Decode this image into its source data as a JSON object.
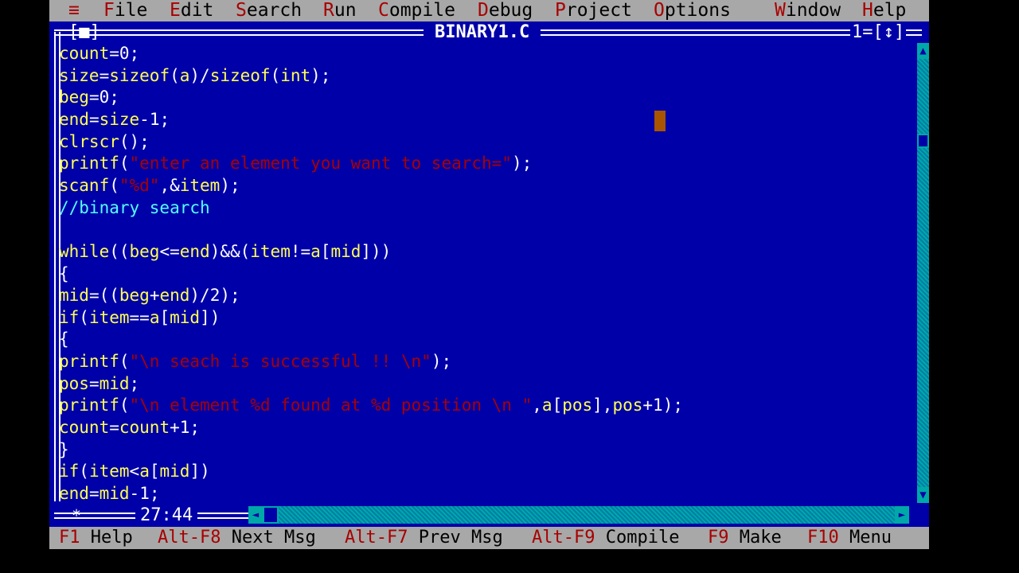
{
  "menu": {
    "system": "≡",
    "items": [
      {
        "hot": "F",
        "rest": "ile"
      },
      {
        "hot": "E",
        "rest": "dit"
      },
      {
        "hot": "S",
        "rest": "earch"
      },
      {
        "hot": "R",
        "rest": "un"
      },
      {
        "hot": "C",
        "rest": "ompile"
      },
      {
        "hot": "D",
        "rest": "ebug"
      },
      {
        "hot": "P",
        "rest": "roject"
      },
      {
        "hot": "O",
        "rest": "ptions"
      },
      {
        "hot": "W",
        "rest": "indow"
      },
      {
        "hot": "H",
        "rest": "elp"
      }
    ]
  },
  "window": {
    "close_box": "[■]",
    "title": "BINARY1.C",
    "number": "1=[↕]"
  },
  "editor": {
    "lines": [
      [
        {
          "t": "count",
          "c": "id"
        },
        {
          "t": "=",
          "c": "op"
        },
        {
          "t": "0",
          "c": "num"
        },
        {
          "t": ";",
          "c": "op"
        }
      ],
      [
        {
          "t": "size",
          "c": "id"
        },
        {
          "t": "=",
          "c": "op"
        },
        {
          "t": "sizeof",
          "c": "id"
        },
        {
          "t": "(",
          "c": "op"
        },
        {
          "t": "a",
          "c": "id"
        },
        {
          "t": ")/",
          "c": "op"
        },
        {
          "t": "sizeof",
          "c": "id"
        },
        {
          "t": "(",
          "c": "op"
        },
        {
          "t": "int",
          "c": "id"
        },
        {
          "t": ");",
          "c": "op"
        }
      ],
      [
        {
          "t": "beg",
          "c": "id"
        },
        {
          "t": "=",
          "c": "op"
        },
        {
          "t": "0",
          "c": "num"
        },
        {
          "t": ";",
          "c": "op"
        }
      ],
      [
        {
          "t": "end",
          "c": "id"
        },
        {
          "t": "=",
          "c": "op"
        },
        {
          "t": "size",
          "c": "id"
        },
        {
          "t": "-",
          "c": "op"
        },
        {
          "t": "1",
          "c": "num"
        },
        {
          "t": ";",
          "c": "op"
        }
      ],
      [
        {
          "t": "clrscr",
          "c": "id"
        },
        {
          "t": "();",
          "c": "op"
        }
      ],
      [
        {
          "t": "printf",
          "c": "id"
        },
        {
          "t": "(",
          "c": "op"
        },
        {
          "t": "\"enter an element you want to search=\"",
          "c": "str"
        },
        {
          "t": ");",
          "c": "op"
        }
      ],
      [
        {
          "t": "scanf",
          "c": "id"
        },
        {
          "t": "(",
          "c": "op"
        },
        {
          "t": "\"%d\"",
          "c": "str"
        },
        {
          "t": ",&",
          "c": "op"
        },
        {
          "t": "item",
          "c": "id"
        },
        {
          "t": ");",
          "c": "op"
        }
      ],
      [
        {
          "t": "//binary search",
          "c": "cmt"
        }
      ],
      [],
      [
        {
          "t": "while",
          "c": "id"
        },
        {
          "t": "((",
          "c": "op"
        },
        {
          "t": "beg",
          "c": "id"
        },
        {
          "t": "<=",
          "c": "op"
        },
        {
          "t": "end",
          "c": "id"
        },
        {
          "t": ")&&(",
          "c": "op"
        },
        {
          "t": "item",
          "c": "id"
        },
        {
          "t": "!=",
          "c": "op"
        },
        {
          "t": "a",
          "c": "id"
        },
        {
          "t": "[",
          "c": "op"
        },
        {
          "t": "mid",
          "c": "id"
        },
        {
          "t": "]))",
          "c": "op"
        }
      ],
      [
        {
          "t": "{",
          "c": "op"
        }
      ],
      [
        {
          "t": "mid",
          "c": "id"
        },
        {
          "t": "=((",
          "c": "op"
        },
        {
          "t": "beg",
          "c": "id"
        },
        {
          "t": "+",
          "c": "op"
        },
        {
          "t": "end",
          "c": "id"
        },
        {
          "t": ")/",
          "c": "op"
        },
        {
          "t": "2",
          "c": "num"
        },
        {
          "t": ");",
          "c": "op"
        }
      ],
      [
        {
          "t": "if",
          "c": "id"
        },
        {
          "t": "(",
          "c": "op"
        },
        {
          "t": "item",
          "c": "id"
        },
        {
          "t": "==",
          "c": "op"
        },
        {
          "t": "a",
          "c": "id"
        },
        {
          "t": "[",
          "c": "op"
        },
        {
          "t": "mid",
          "c": "id"
        },
        {
          "t": "])",
          "c": "op"
        }
      ],
      [
        {
          "t": "{",
          "c": "op"
        }
      ],
      [
        {
          "t": "printf",
          "c": "id"
        },
        {
          "t": "(",
          "c": "op"
        },
        {
          "t": "\"\\n seach is successful !! \\n\"",
          "c": "str"
        },
        {
          "t": ");",
          "c": "op"
        }
      ],
      [
        {
          "t": "pos",
          "c": "id"
        },
        {
          "t": "=",
          "c": "op"
        },
        {
          "t": "mid",
          "c": "id"
        },
        {
          "t": ";",
          "c": "op"
        }
      ],
      [
        {
          "t": "printf",
          "c": "id"
        },
        {
          "t": "(",
          "c": "op"
        },
        {
          "t": "\"\\n element %d found at %d position \\n \"",
          "c": "str"
        },
        {
          "t": ",",
          "c": "op"
        },
        {
          "t": "a",
          "c": "id"
        },
        {
          "t": "[",
          "c": "op"
        },
        {
          "t": "pos",
          "c": "id"
        },
        {
          "t": "],",
          "c": "op"
        },
        {
          "t": "pos",
          "c": "id"
        },
        {
          "t": "+",
          "c": "op"
        },
        {
          "t": "1",
          "c": "num"
        },
        {
          "t": ");",
          "c": "op"
        }
      ],
      [
        {
          "t": "count",
          "c": "id"
        },
        {
          "t": "=",
          "c": "op"
        },
        {
          "t": "count",
          "c": "id"
        },
        {
          "t": "+",
          "c": "op"
        },
        {
          "t": "1",
          "c": "num"
        },
        {
          "t": ";",
          "c": "op"
        }
      ],
      [
        {
          "t": "}",
          "c": "op"
        }
      ],
      [
        {
          "t": "if",
          "c": "id"
        },
        {
          "t": "(",
          "c": "op"
        },
        {
          "t": "item",
          "c": "id"
        },
        {
          "t": "<",
          "c": "op"
        },
        {
          "t": "a",
          "c": "id"
        },
        {
          "t": "[",
          "c": "op"
        },
        {
          "t": "mid",
          "c": "id"
        },
        {
          "t": "])",
          "c": "op"
        }
      ],
      [
        {
          "t": "end",
          "c": "id"
        },
        {
          "t": "=",
          "c": "op"
        },
        {
          "t": "mid",
          "c": "id"
        },
        {
          "t": "-",
          "c": "op"
        },
        {
          "t": "1",
          "c": "num"
        },
        {
          "t": ";",
          "c": "op"
        }
      ]
    ]
  },
  "position": {
    "modified_marker": "*",
    "line_col": "27:44"
  },
  "scrollbars": {
    "up_arrow": "▲",
    "down_arrow": "▼",
    "left_arrow": "◄",
    "right_arrow": "►"
  },
  "status": {
    "keys": [
      {
        "key": "F1",
        "label": "Help"
      },
      {
        "key": "Alt-F8",
        "label": "Next Msg"
      },
      {
        "key": "Alt-F7",
        "label": "Prev Msg"
      },
      {
        "key": "Alt-F9",
        "label": "Compile"
      },
      {
        "key": "F9",
        "label": "Make"
      },
      {
        "key": "F10",
        "label": "Menu"
      }
    ]
  },
  "colors": {
    "editor_bg": "#0000a8",
    "identifier": "#ffff55",
    "string": "#a80000",
    "comment": "#55ffff",
    "menu_bg": "#a8a8a8",
    "hotkey": "#a80000"
  }
}
